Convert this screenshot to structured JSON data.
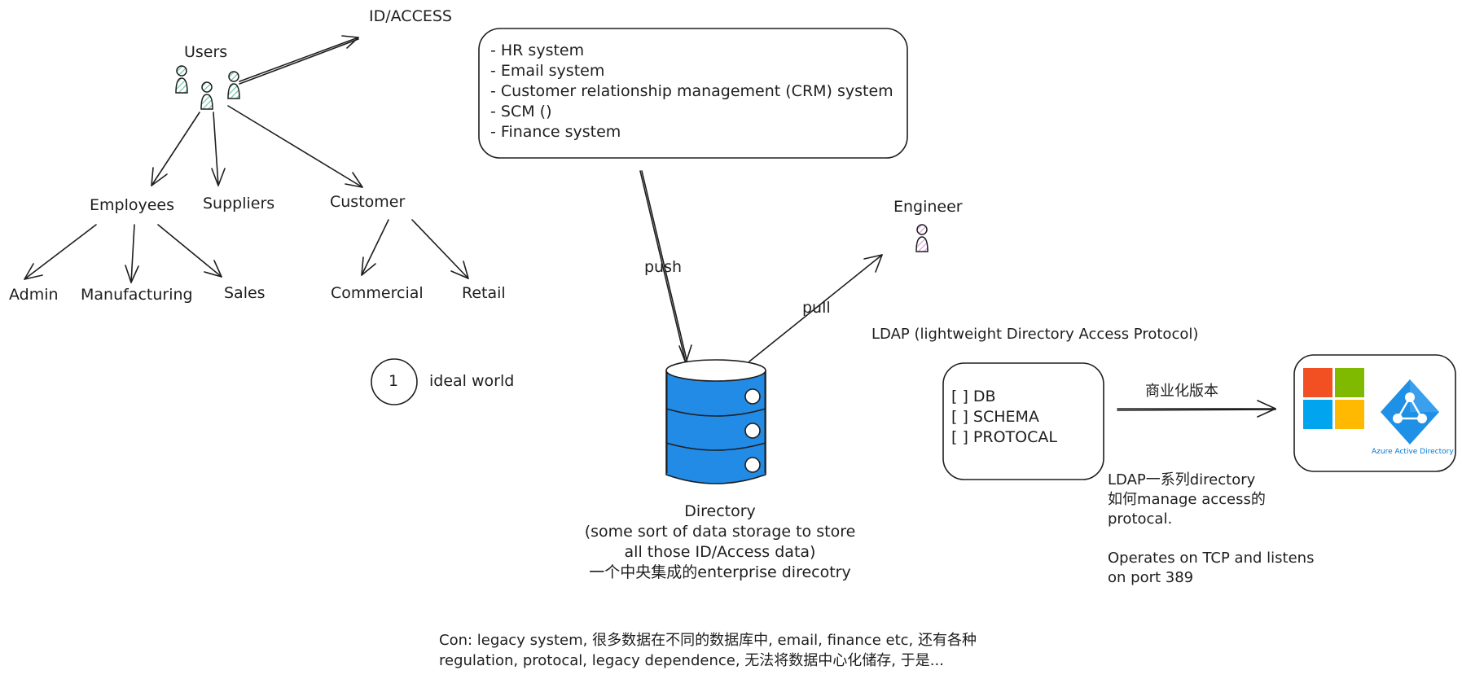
{
  "diagram": {
    "id_access": "ID/ACCESS",
    "users": "Users",
    "employees": "Employees",
    "suppliers": "Suppliers",
    "customer": "Customer",
    "admin": "Admin",
    "manufacturing": "Manufacturing",
    "sales": "Sales",
    "commercial": "Commercial",
    "retail": "Retail",
    "systems": [
      "- HR system",
      "- Email system",
      "- Customer relationship management (CRM) system",
      "- SCM ()",
      "- Finance system"
    ],
    "push": "push",
    "pull": "pull",
    "engineer": "Engineer",
    "step_number": "1",
    "ideal_world": "ideal world",
    "directory_lines": [
      "Directory",
      "(some sort of data storage to store",
      "all those ID/Access data)",
      "一个中央集成的enterprise direcotry"
    ],
    "ldap_title": "LDAP (lightweight Directory Access Protocol)",
    "checklist": [
      "[ ] DB",
      "[ ] SCHEMA",
      "[ ] PROTOCAL"
    ],
    "commercial_version": "商业化版本",
    "azure_label": "Azure Active Directory",
    "ldap_desc": [
      "LDAP一系列directory",
      "如何manage access的",
      "protocal.",
      "",
      "Operates on TCP and listens",
      "on port 389"
    ],
    "con_text": [
      "Con: legacy system, 很多数据在不同的数据库中, email, finance etc, 还有各种",
      "regulation, protocal, legacy dependence, 无法将数据中心化储存, 于是..."
    ]
  },
  "colors": {
    "stroke": "#1e1e1e",
    "user_fill": "#a8e0cf",
    "engineer_fill": "#e6b8e8",
    "db_fill": "#228be6",
    "ms_red": "#f25022",
    "ms_green": "#7fba00",
    "ms_blue": "#00a4ef",
    "ms_yellow": "#ffb900",
    "azure_blue": "#0078d4"
  }
}
